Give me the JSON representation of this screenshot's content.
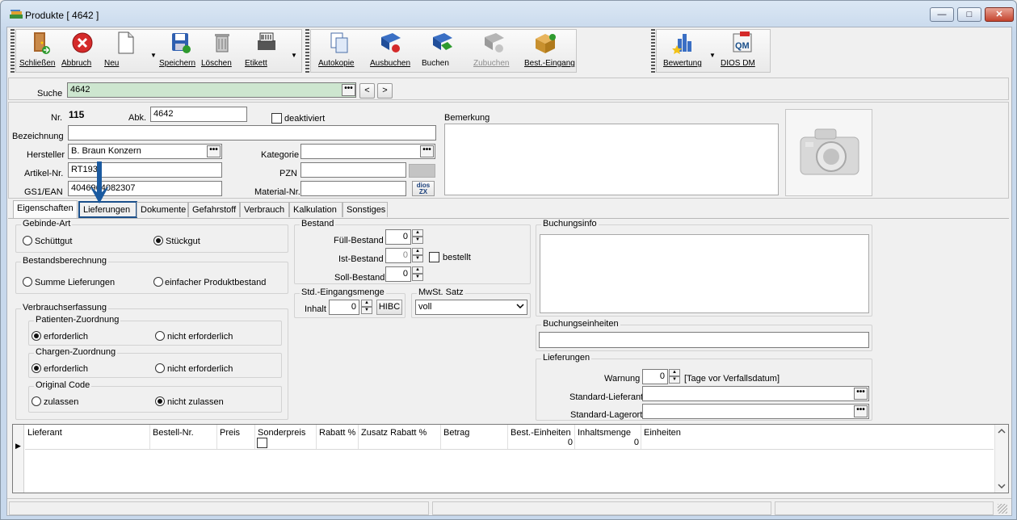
{
  "window": {
    "title": "Produkte [ 4642 ]",
    "app_icon": "books-icon",
    "minimize": "—",
    "maximize": "□",
    "close": "✕"
  },
  "toolbar": {
    "close_label": "Schließen",
    "cancel_label": "Abbruch",
    "new_label": "Neu",
    "save_label": "Speichern",
    "delete_label": "Löschen",
    "label_label": "Etikett",
    "autocopy_label": "Autokopie",
    "book_out_label": "Ausbuchen",
    "book_label": "Buchen",
    "book_in_label": "Zubuchen",
    "order_entry_label": "Best.-Eingang",
    "rating_label": "Bewertung",
    "dios_label": "DIOS DM",
    "dropdown_arrow": "▼"
  },
  "search": {
    "label": "Suche",
    "value": "4642",
    "ellipsis": "•••",
    "prev": "<",
    "next": ">"
  },
  "form": {
    "nr_label": "Nr.",
    "nr_value": "115",
    "abk_label": "Abk.",
    "abk_value": "4642",
    "deaktiviert_label": "deaktiviert",
    "bezeichnung_label": "Bezeichnung",
    "bezeichnung_value": "",
    "hersteller_label": "Hersteller",
    "hersteller_value": "B. Braun Konzern",
    "artikel_label": "Artikel-Nr.",
    "artikel_value": "RT193",
    "gs1_label": "GS1/EAN",
    "gs1_value": "4046964082307",
    "kategorie_label": "Kategorie",
    "kategorie_value": "",
    "pzn_label": "PZN",
    "pzn_value": "",
    "material_label": "Material-Nr.",
    "material_value": "",
    "bemerkung_label": "Bemerkung",
    "bemerkung_value": "",
    "dios_zx": "dios ZX"
  },
  "tabs": [
    "Eigenschaften",
    "Lieferungen",
    "Dokumente",
    "Gefahrstoff",
    "Verbrauch",
    "Kalkulation",
    "Sonstiges"
  ],
  "left": {
    "gebinde_title": "Gebinde-Art",
    "schuettgut": "Schüttgut",
    "stueckgut": "Stückgut",
    "bestandsber_title": "Bestandsberechnung",
    "summe": "Summe Lieferungen",
    "einfacher": "einfacher Produktbestand",
    "verbrauch_title": "Verbrauchserfassung",
    "patient_title": "Patienten-Zuordnung",
    "chargen_title": "Chargen-Zuordnung",
    "original_title": "Original Code",
    "erforderlich": "erforderlich",
    "nicht_erforderlich": "nicht erforderlich",
    "zulassen": "zulassen",
    "nicht_zulassen": "nicht zulassen"
  },
  "bestand": {
    "title": "Bestand",
    "fuell_label": "Füll-Bestand",
    "fuell_value": "0",
    "ist_label": "Ist-Bestand",
    "ist_value": "0",
    "bestellt_label": "bestellt",
    "soll_label": "Soll-Bestand",
    "soll_value": "0",
    "spin_up": "▲",
    "spin_down": "▼"
  },
  "std": {
    "title": "Std.-Eingangsmenge",
    "inhalt_label": "Inhalt",
    "inhalt_value": "0",
    "hibc": "HIBC"
  },
  "mwst": {
    "title": "MwSt. Satz",
    "value": "voll"
  },
  "right": {
    "buchungsinfo": "Buchungsinfo",
    "buchungseinheiten": "Buchungseinheiten",
    "lieferungen": "Lieferungen",
    "warnung_label": "Warnung",
    "warnung_value": "0",
    "tage_label": "[Tage vor Verfallsdatum]",
    "std_lieferant_label": "Standard-Lieferant",
    "std_lieferant_value": "",
    "std_lagerort_label": "Standard-Lagerort",
    "std_lagerort_value": ""
  },
  "grid": {
    "columns": [
      "Lieferant",
      "Bestell-Nr.",
      "Preis",
      "Sonderpreis",
      "Rabatt %",
      "Zusatz Rabatt %",
      "Betrag",
      "Best.-Einheiten",
      "Inhaltsmenge",
      "Einheiten"
    ],
    "row": {
      "best_einheiten": "0",
      "inhaltsmenge": "0"
    },
    "row_marker": "▶",
    "scroll_up": "ⱏ",
    "scroll_down": "ⱏ"
  },
  "annotation": {
    "arrow_color": "#1a5aa0"
  }
}
